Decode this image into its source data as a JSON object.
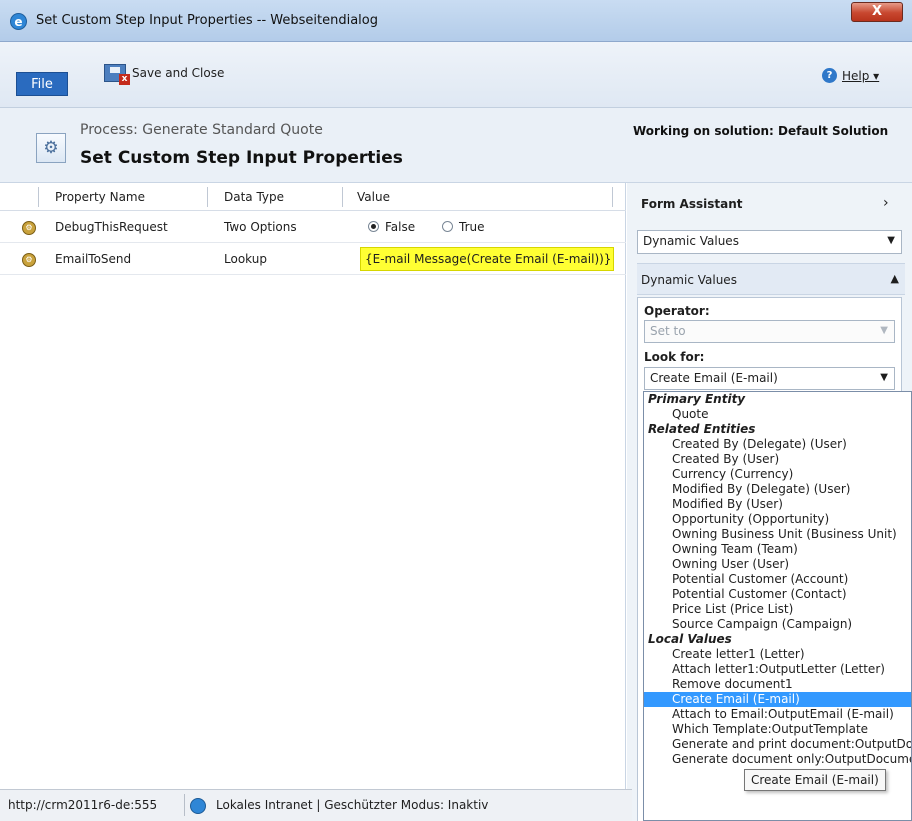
{
  "window": {
    "title": "Set Custom Step Input Properties -- Webseitendialog",
    "close_label": "X"
  },
  "ribbon": {
    "file_label": "File",
    "save_close_label": "Save and Close",
    "help_label": "Help ▾"
  },
  "header": {
    "process_title": "Process: Generate Standard Quote",
    "page_title": "Set Custom Step Input Properties",
    "solution_text": "Working on solution: Default Solution"
  },
  "grid": {
    "columns": [
      "Property Name",
      "Data Type",
      "Value"
    ],
    "rows": [
      {
        "name": "DebugThisRequest",
        "type": "Two Options",
        "option_false": "False",
        "option_true": "True",
        "selected": "False"
      },
      {
        "name": "EmailToSend",
        "type": "Lookup",
        "value": "{E-mail Message(Create Email (E-mail))}"
      }
    ]
  },
  "panel": {
    "form_assistant": "Form Assistant",
    "dynamic_values_select": "Dynamic Values",
    "dynamic_values_section": "Dynamic Values",
    "operator_label": "Operator:",
    "operator_value": "Set to",
    "look_for_label": "Look for:",
    "look_for_value": "Create Email (E-mail)"
  },
  "dropdown": {
    "groups": [
      {
        "heading": "Primary Entity",
        "items": [
          "Quote"
        ]
      },
      {
        "heading": "Related Entities",
        "items": [
          "Created By (Delegate) (User)",
          "Created By (User)",
          "Currency (Currency)",
          "Modified By (Delegate) (User)",
          "Modified By (User)",
          "Opportunity (Opportunity)",
          "Owning Business Unit (Business Unit)",
          "Owning Team (Team)",
          "Owning User (User)",
          "Potential Customer (Account)",
          "Potential Customer (Contact)",
          "Price List (Price List)",
          "Source Campaign (Campaign)"
        ]
      },
      {
        "heading": "Local Values",
        "items": [
          "Create letter1 (Letter)",
          "Attach letter1:OutputLetter (Letter)",
          "Remove document1",
          "Create Email (E-mail)",
          "Attach to Email:OutputEmail (E-mail)",
          "Which Template:OutputTemplate",
          "Generate and print document:OutputDocument",
          "Generate document only:OutputDocument"
        ]
      }
    ],
    "selected": "Create Email (E-mail)",
    "tooltip": "Create Email (E-mail)"
  },
  "statusbar": {
    "url": "http://crm2011r6-de:555",
    "zone": "Lokales Intranet | Geschützter Modus: Inaktiv"
  },
  "colors": {
    "titlebar": "#c9dcf2",
    "file_button": "#2a6bbf",
    "lookup_highlight": "#ffff33",
    "selected_item": "#3399ff"
  }
}
